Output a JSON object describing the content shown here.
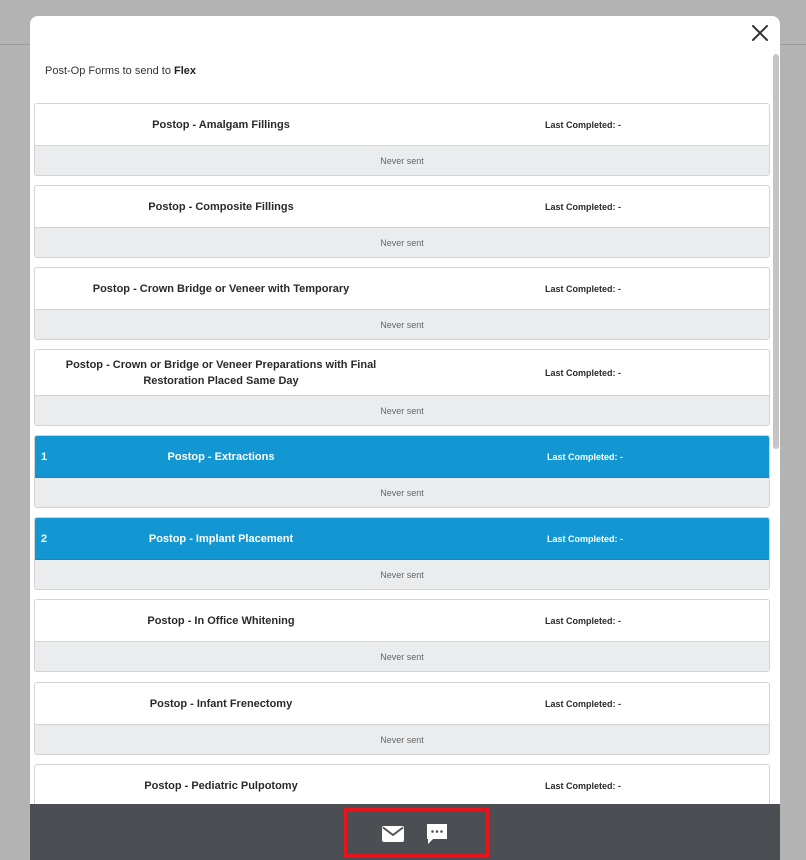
{
  "modal": {
    "title_prefix": "Post-Op Forms to send to",
    "patient_name": "Flex",
    "close_icon": "close-icon"
  },
  "forms": [
    {
      "name": "Postop - Amalgam Fillings",
      "last_completed": "Last Completed: -",
      "status": "Never sent",
      "selected": false,
      "order": ""
    },
    {
      "name": "Postop - Composite Fillings",
      "last_completed": "Last Completed: -",
      "status": "Never sent",
      "selected": false,
      "order": ""
    },
    {
      "name": "Postop - Crown Bridge or Veneer with Temporary",
      "last_completed": "Last Completed: -",
      "status": "Never sent",
      "selected": false,
      "order": ""
    },
    {
      "name": "Postop - Crown or Bridge or Veneer Preparations with Final Restoration Placed Same Day",
      "last_completed": "Last Completed: -",
      "status": "Never sent",
      "selected": false,
      "order": ""
    },
    {
      "name": "Postop - Extractions",
      "last_completed": "Last Completed: -",
      "status": "Never sent",
      "selected": true,
      "order": "1"
    },
    {
      "name": "Postop - Implant Placement",
      "last_completed": "Last Completed: -",
      "status": "Never sent",
      "selected": true,
      "order": "2"
    },
    {
      "name": "Postop - In Office Whitening",
      "last_completed": "Last Completed: -",
      "status": "Never sent",
      "selected": false,
      "order": ""
    },
    {
      "name": "Postop - Infant Frenectomy",
      "last_completed": "Last Completed: -",
      "status": "Never sent",
      "selected": false,
      "order": ""
    },
    {
      "name": "Postop - Pediatric Pulpotomy",
      "last_completed": "Last Completed: -",
      "status": "",
      "selected": false,
      "order": ""
    }
  ],
  "footer": {
    "email_icon": "email-icon",
    "sms_icon": "sms-icon"
  },
  "colors": {
    "selected": "#1297d2",
    "footer": "#4b4f54",
    "highlight_box": "#e8141b"
  }
}
